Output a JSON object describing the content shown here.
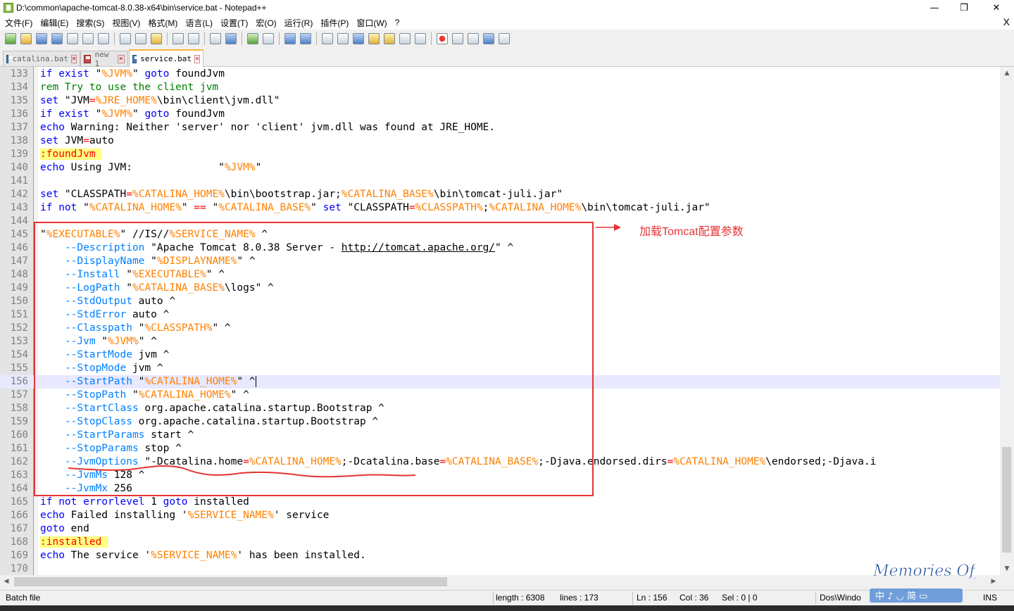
{
  "window": {
    "title": "D:\\common\\apache-tomcat-8.0.38-x64\\bin\\service.bat - Notepad++",
    "minimize": "—",
    "maximize": "❐",
    "close": "✕"
  },
  "menu": {
    "items": [
      "文件(F)",
      "编辑(E)",
      "搜索(S)",
      "视图(V)",
      "格式(M)",
      "语言(L)",
      "设置(T)",
      "宏(O)",
      "运行(R)",
      "插件(P)",
      "窗口(W)",
      "?"
    ],
    "close_doc": "X"
  },
  "tabs": [
    {
      "label": "catalina.bat",
      "active": false
    },
    {
      "label": "new 1",
      "active": false
    },
    {
      "label": "service.bat",
      "active": true
    }
  ],
  "editor": {
    "current_line": 156,
    "lines": [
      {
        "n": "133",
        "html": "<span class='kw'>if exist</span> <span class='txt'>\"</span><span class='var'>%JVM%</span><span class='txt'>\" </span><span class='kw'>goto</span><span class='txt'> foundJvm</span>"
      },
      {
        "n": "134",
        "html": "<span class='cm'>rem Try to use the client jvm</span>"
      },
      {
        "n": "135",
        "html": "<span class='kw'>set</span><span class='txt'> \"JVM</span><span class='op'>=</span><span class='var'>%JRE_HOME%</span><span class='txt'>\\bin\\client\\jvm.dll\"</span>"
      },
      {
        "n": "136",
        "html": "<span class='kw'>if exist</span> <span class='txt'>\"</span><span class='var'>%JVM%</span><span class='txt'>\" </span><span class='kw'>goto</span><span class='txt'> foundJvm</span>"
      },
      {
        "n": "137",
        "html": "<span class='kw'>echo</span><span class='txt'> Warning: Neither 'server' nor 'client' jvm.dll was found at JRE_HOME.</span>"
      },
      {
        "n": "138",
        "html": "<span class='kw'>set</span><span class='txt'> JVM</span><span class='op'>=</span><span class='txt'>auto</span>"
      },
      {
        "n": "139",
        "html": "<span class='lbl'>:foundJvm </span>"
      },
      {
        "n": "140",
        "html": "<span class='kw'>echo</span><span class='txt'> Using JVM:              \"</span><span class='var'>%JVM%</span><span class='txt'>\"</span>"
      },
      {
        "n": "141",
        "html": ""
      },
      {
        "n": "142",
        "html": "<span class='kw'>set</span><span class='txt'> \"CLASSPATH</span><span class='op'>=</span><span class='var'>%CATALINA_HOME%</span><span class='txt'>\\bin\\bootstrap.jar;</span><span class='var'>%CATALINA_BASE%</span><span class='txt'>\\bin\\tomcat-juli.jar\"</span>"
      },
      {
        "n": "143",
        "html": "<span class='kw'>if not</span><span class='txt'> \"</span><span class='var'>%CATALINA_HOME%</span><span class='txt'>\" </span><span class='op'>==</span><span class='txt'> \"</span><span class='var'>%CATALINA_BASE%</span><span class='txt'>\" </span><span class='kw'>set</span><span class='txt'> \"CLASSPATH</span><span class='op'>=</span><span class='var'>%CLASSPATH%</span><span class='txt'>;</span><span class='var'>%CATALINA_HOME%</span><span class='txt'>\\bin\\tomcat-juli.jar\"</span>"
      },
      {
        "n": "144",
        "html": ""
      },
      {
        "n": "145",
        "html": "<span class='txt'>\"</span><span class='var'>%EXECUTABLE%</span><span class='txt'>\" //IS//</span><span class='var'>%SERVICE_NAME%</span><span class='txt'> ^</span>"
      },
      {
        "n": "146",
        "html": "<span class='txt'>    </span><span class='opt'>--Description</span><span class='txt'> \"Apache Tomcat 8.0.38 Server - </span><span class='url'>http://tomcat.apache.org/</span><span class='txt'>\" ^</span>"
      },
      {
        "n": "147",
        "html": "<span class='txt'>    </span><span class='opt'>--DisplayName</span><span class='txt'> \"</span><span class='var'>%DISPLAYNAME%</span><span class='txt'>\" ^</span>"
      },
      {
        "n": "148",
        "html": "<span class='txt'>    </span><span class='opt'>--Install</span><span class='txt'> \"</span><span class='var'>%EXECUTABLE%</span><span class='txt'>\" ^</span>"
      },
      {
        "n": "149",
        "html": "<span class='txt'>    </span><span class='opt'>--LogPath</span><span class='txt'> \"</span><span class='var'>%CATALINA_BASE%</span><span class='txt'>\\logs\" ^</span>"
      },
      {
        "n": "150",
        "html": "<span class='txt'>    </span><span class='opt'>--StdOutput</span><span class='txt'> auto ^</span>"
      },
      {
        "n": "151",
        "html": "<span class='txt'>    </span><span class='opt'>--StdError</span><span class='txt'> auto ^</span>"
      },
      {
        "n": "152",
        "html": "<span class='txt'>    </span><span class='opt'>--Classpath</span><span class='txt'> \"</span><span class='var'>%CLASSPATH%</span><span class='txt'>\" ^</span>"
      },
      {
        "n": "153",
        "html": "<span class='txt'>    </span><span class='opt'>--Jvm</span><span class='txt'> \"</span><span class='var'>%JVM%</span><span class='txt'>\" ^</span>"
      },
      {
        "n": "154",
        "html": "<span class='txt'>    </span><span class='opt'>--StartMode</span><span class='txt'> jvm ^</span>"
      },
      {
        "n": "155",
        "html": "<span class='txt'>    </span><span class='opt'>--StopMode</span><span class='txt'> jvm ^</span>"
      },
      {
        "n": "156",
        "html": "<span class='txt'>    </span><span class='opt'>--StartPath</span><span class='txt'> \"</span><span class='var'>%CATALINA_HOME%</span><span class='txt'>\" ^</span><span class='caret'></span>"
      },
      {
        "n": "157",
        "html": "<span class='txt'>    </span><span class='opt'>--StopPath</span><span class='txt'> \"</span><span class='var'>%CATALINA_HOME%</span><span class='txt'>\" ^</span>"
      },
      {
        "n": "158",
        "html": "<span class='txt'>    </span><span class='opt'>--StartClass</span><span class='txt'> org.apache.catalina.startup.Bootstrap ^</span>"
      },
      {
        "n": "159",
        "html": "<span class='txt'>    </span><span class='opt'>--StopClass</span><span class='txt'> org.apache.catalina.startup.Bootstrap ^</span>"
      },
      {
        "n": "160",
        "html": "<span class='txt'>    </span><span class='opt'>--StartParams</span><span class='txt'> start ^</span>"
      },
      {
        "n": "161",
        "html": "<span class='txt'>    </span><span class='opt'>--StopParams</span><span class='txt'> stop ^</span>"
      },
      {
        "n": "162",
        "html": "<span class='txt'>    </span><span class='opt'>--JvmOptions</span><span class='txt'> \"-Dcatalina.home</span><span class='op'>=</span><span class='var'>%CATALINA_HOME%</span><span class='txt'>;-Dcatalina.base</span><span class='op'>=</span><span class='var'>%CATALINA_BASE%</span><span class='txt'>;-Djava.endorsed.dirs</span><span class='op'>=</span><span class='var'>%CATALINA_HOME%</span><span class='txt'>\\endorsed;-Djava.i</span>"
      },
      {
        "n": "163",
        "html": "<span class='txt'>    </span><span class='opt'>--JvmMs</span><span class='txt'> 128 ^</span>"
      },
      {
        "n": "164",
        "html": "<span class='txt'>    </span><span class='opt'>--JvmMx</span><span class='txt'> 256</span>"
      },
      {
        "n": "165",
        "html": "<span class='kw'>if not errorlevel</span><span class='txt'> 1 </span><span class='kw'>goto</span><span class='txt'> installed</span>"
      },
      {
        "n": "166",
        "html": "<span class='kw'>echo</span><span class='txt'> Failed installing '</span><span class='var'>%SERVICE_NAME%</span><span class='txt'>' service</span>"
      },
      {
        "n": "167",
        "html": "<span class='kw'>goto</span><span class='txt'> end</span>"
      },
      {
        "n": "168",
        "html": "<span class='lbl'>:installed </span>"
      },
      {
        "n": "169",
        "html": "<span class='kw'>echo</span><span class='txt'> The service '</span><span class='var'>%SERVICE_NAME%</span><span class='txt'>' has been installed.</span>"
      },
      {
        "n": "170",
        "html": ""
      }
    ]
  },
  "annotation": {
    "label": "加载Tomcat配置参数",
    "color": "#e53333"
  },
  "status": {
    "file_type": "Batch file",
    "length": "length : 6308",
    "lines": "lines : 173",
    "ln": "Ln : 156",
    "col": "Col : 36",
    "sel": "Sel : 0 | 0",
    "eol": "Dos\\Windo",
    "mode": "INS"
  },
  "overlay_logo": {
    "text": "Memories Off",
    "ime": "中 ♪ ◡ 简 ▭"
  }
}
